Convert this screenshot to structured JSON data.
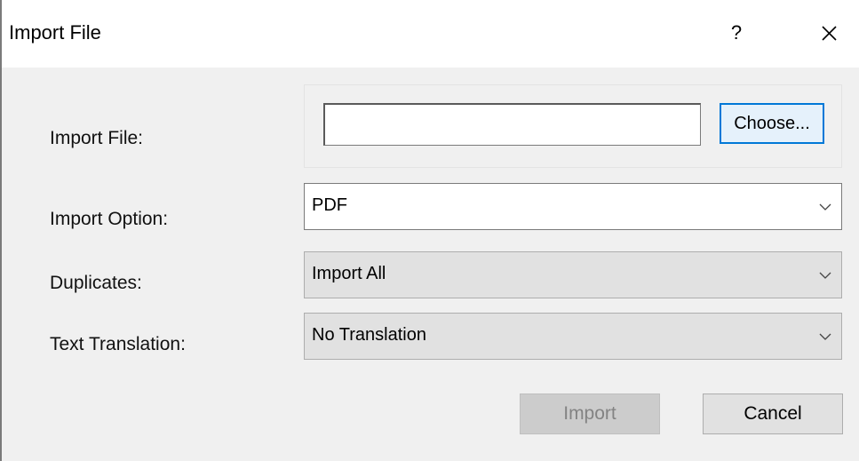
{
  "window": {
    "title": "Import File",
    "help_label": "?"
  },
  "form": {
    "import_file": {
      "label": "Import File:",
      "value": "",
      "placeholder": "",
      "choose_label": "Choose..."
    },
    "import_option": {
      "label": "Import Option:",
      "selected": "PDF"
    },
    "duplicates": {
      "label": "Duplicates:",
      "selected": "Import All"
    },
    "text_translation": {
      "label": "Text Translation:",
      "selected": "No Translation"
    }
  },
  "buttons": {
    "import_label": "Import",
    "cancel_label": "Cancel"
  },
  "icons": {
    "close": "close-icon",
    "dropdown": "chevron-down-icon"
  },
  "colors": {
    "focus_border": "#0078d7",
    "dialog_bg": "#f0f0f0",
    "disabled_text": "#838383"
  }
}
